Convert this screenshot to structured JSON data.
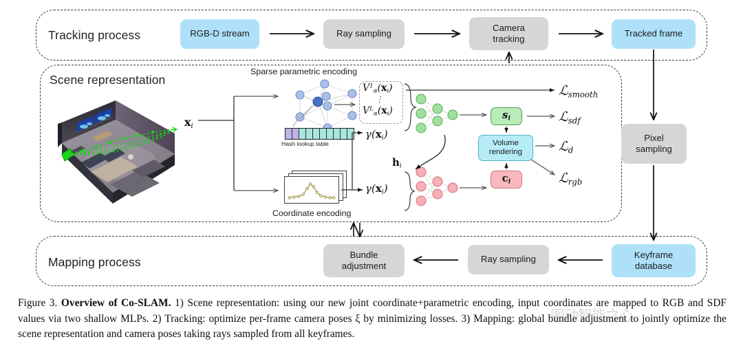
{
  "figure": {
    "number": "Figure 3.",
    "title": "Overview of Co-SLAM.",
    "caption_part1": " 1) Scene representation: using our new joint coordinate+parametric encoding, input coordinates are mapped to RGB and SDF values via two shallow MLPs.  2) Tracking: optimize per-frame camera poses ξ by minimizing losses.  3) Mapping: global bundle adjustment to jointly optimize the scene representation and camera poses taking rays sampled from all keyframes.",
    "watermark_text": "图动智能之心"
  },
  "panels": {
    "tracking": {
      "title": "Tracking process"
    },
    "scene": {
      "title": "Scene representation"
    },
    "mapping": {
      "title": "Mapping process"
    }
  },
  "tracking_steps": [
    {
      "label": "RGB-D stream",
      "color": "blue"
    },
    {
      "label": "Ray sampling",
      "color": "grey"
    },
    {
      "label": "Camera\ntracking",
      "color": "grey"
    },
    {
      "label": "Tracked frame",
      "color": "blue"
    }
  ],
  "mapping_steps": [
    {
      "label": "Bundle\nadjustment",
      "color": "grey"
    },
    {
      "label": "Ray sampling",
      "color": "grey"
    },
    {
      "label": "Keyframe\ndatabase",
      "color": "blue"
    }
  ],
  "right_column": [
    {
      "label": "Pixel\nsampling",
      "color": "grey"
    }
  ],
  "scene": {
    "sparse_encoding_label": "Sparse parametric encoding",
    "coordinate_encoding_label": "Coordinate encoding",
    "hash_table_label": "Hash lookup table",
    "input_point": "x",
    "input_point_sub": "i",
    "v_first": "V¹α(xᵢ)",
    "v_last": "Vᴸα(xᵢ)",
    "gamma_top": "γ(xᵢ)",
    "gamma_bottom": "γ(xᵢ)",
    "hidden_feature": "hᵢ",
    "sdf_out": "s",
    "sdf_out_sub": "i",
    "color_out": "c",
    "color_out_sub": "i",
    "volume_rendering": "Volume\nrendering"
  },
  "losses": [
    {
      "symbol": "L",
      "name": "smooth"
    },
    {
      "symbol": "L",
      "name": "sdf"
    },
    {
      "symbol": "L",
      "name": "d"
    },
    {
      "symbol": "L",
      "name": "rgb"
    }
  ],
  "colors": {
    "blue_box": "#aee1f9",
    "grey_box": "#d6d6d6",
    "green_node": "#9fe09f",
    "pink_node": "#f7b0b6",
    "sdf_box": "#b9ecb9",
    "color_box": "#f7b9bd",
    "render_box": "#b6ecf7",
    "hash_cell": "#a8e6dc",
    "hash_cell_highlight": "#bdb3e8",
    "voxel_node": "#a8bfe8",
    "voxel_node_active": "#4a72c4",
    "ray": "#16d916",
    "panel_border": "#3a3a3a"
  }
}
